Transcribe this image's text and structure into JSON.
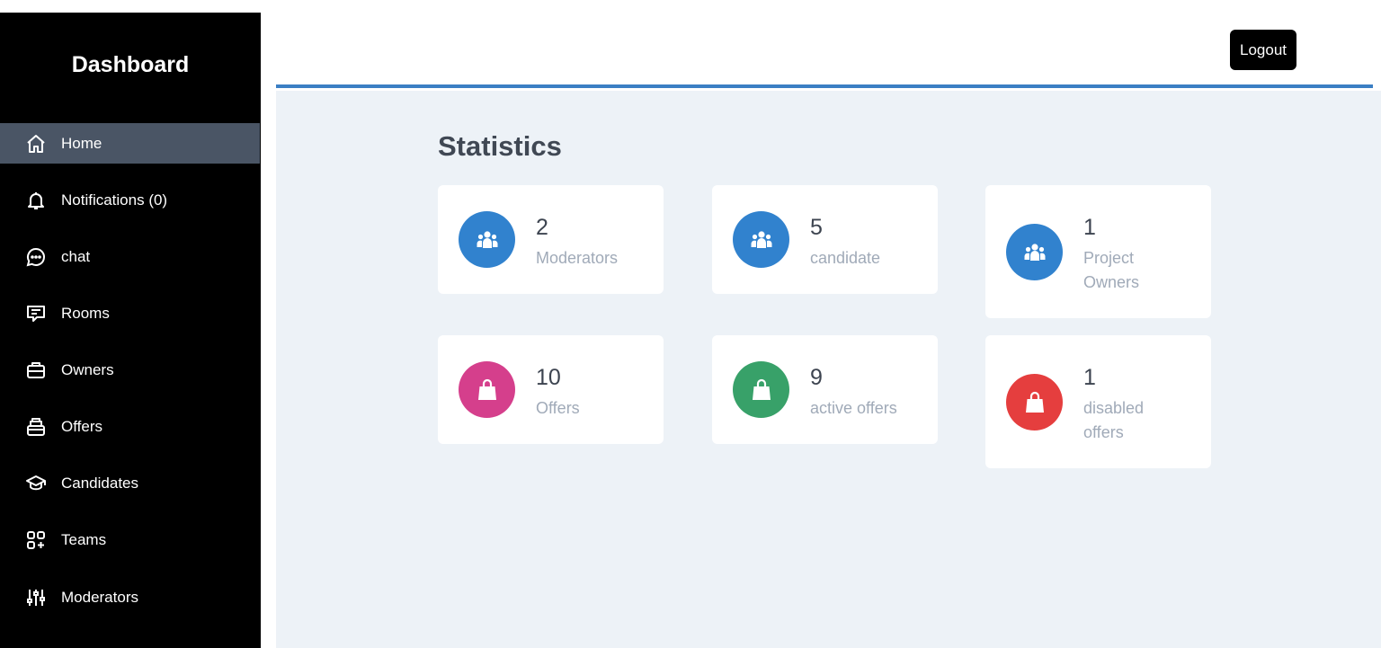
{
  "sidebar": {
    "title": "Dashboard",
    "items": [
      {
        "label": "Home",
        "icon": "home-icon",
        "active": true
      },
      {
        "label": "Notifications (0)",
        "icon": "bell-icon"
      },
      {
        "label": "chat",
        "icon": "chat-icon"
      },
      {
        "label": "Rooms",
        "icon": "message-square-icon"
      },
      {
        "label": "Owners",
        "icon": "briefcase-icon"
      },
      {
        "label": "Offers",
        "icon": "inbox-icon"
      },
      {
        "label": "Candidates",
        "icon": "graduation-cap-icon"
      },
      {
        "label": "Teams",
        "icon": "apps-add-icon"
      },
      {
        "label": "Moderators",
        "icon": "sliders-icon"
      }
    ]
  },
  "header": {
    "logout_label": "Logout",
    "accent_color": "#3b7fc4"
  },
  "main": {
    "title": "Statistics",
    "cards": [
      {
        "value": "2",
        "label": "Moderators",
        "icon": "users-icon",
        "color": "#3182ce"
      },
      {
        "value": "5",
        "label": "candidate",
        "icon": "users-icon",
        "color": "#3182ce"
      },
      {
        "value": "1",
        "label": "Project Owners",
        "icon": "users-icon",
        "color": "#3182ce"
      },
      {
        "value": "10",
        "label": "Offers",
        "icon": "shopping-bag-icon",
        "color": "#d53f8c"
      },
      {
        "value": "9",
        "label": "active offers",
        "icon": "shopping-bag-icon",
        "color": "#38a169"
      },
      {
        "value": "1",
        "label": "disabled offers",
        "icon": "shopping-bag-icon",
        "color": "#e53e3e"
      }
    ]
  }
}
